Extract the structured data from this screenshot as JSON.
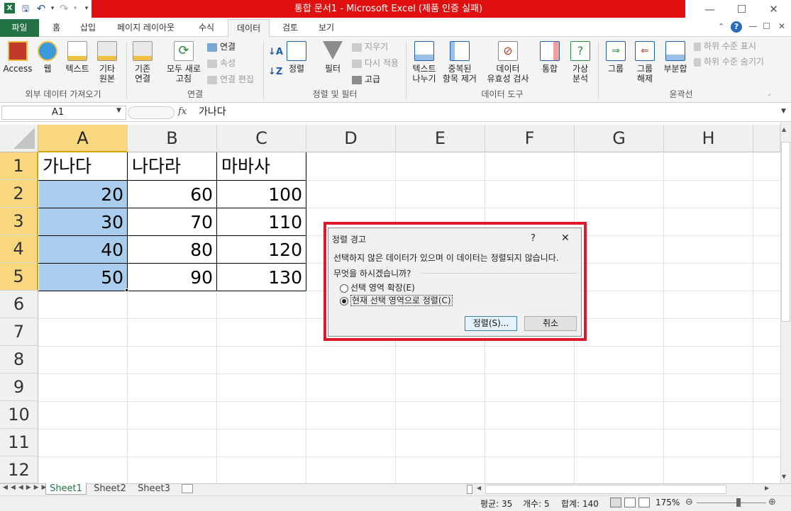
{
  "window": {
    "title": "통합 문서1 - Microsoft Excel (제품 인증 실패)",
    "min_glyph": "—",
    "max_glyph": "☐",
    "close_glyph": "✕"
  },
  "quick_access": {
    "excel_glyph": "X",
    "save_glyph": "🖫",
    "undo_glyph": "↶",
    "redo_glyph": "↷",
    "more_glyph": "▾"
  },
  "ribbon_tabs": [
    "파일",
    "홈",
    "삽입",
    "페이지 레이아웃",
    "수식",
    "데이터",
    "검토",
    "보기"
  ],
  "ribbon": {
    "external": {
      "access": "Access",
      "web": "웹",
      "text": "텍스트",
      "other_1": "기타",
      "other_2": "원본",
      "group": "외부 데이터 가져오기"
    },
    "connections": {
      "existing_1": "기존",
      "existing_2": "연결",
      "refresh_1": "모두 새로",
      "refresh_2": "고침",
      "connections": "연결",
      "properties": "속성",
      "edit_links": "연결 편집",
      "group": "연결"
    },
    "sort_filter": {
      "sort": "정렬",
      "filter": "필터",
      "clear": "지우기",
      "reapply": "다시 적용",
      "advanced": "고급",
      "group": "정렬 및 필터"
    },
    "data_tools": {
      "text_to_columns_1": "텍스트",
      "text_to_columns_2": "나누기",
      "remove_dup_1": "중복된",
      "remove_dup_2": "항목 제거",
      "validation_1": "데이터",
      "validation_2": "유효성 검사",
      "consolidate": "통합",
      "whatif_1": "가상",
      "whatif_2": "분석",
      "group": "데이터 도구"
    },
    "outline": {
      "group_1": "그룹",
      "ungroup_1": "그룹",
      "ungroup_2": "해제",
      "subtotal": "부분합",
      "show_detail": "하위 수준 표시",
      "hide_detail": "하위 수준 숨기기",
      "group": "윤곽선"
    }
  },
  "formula_bar": {
    "name_box": "A1",
    "fx": "fx",
    "value": "가나다"
  },
  "columns": [
    "A",
    "B",
    "C",
    "D",
    "E",
    "F",
    "G",
    "H"
  ],
  "rows": [
    "1",
    "2",
    "3",
    "4",
    "5",
    "6",
    "7",
    "8",
    "9",
    "10",
    "11",
    "12"
  ],
  "cells": {
    "header": [
      "가나다",
      "나다라",
      "마바사"
    ],
    "data": [
      [
        "20",
        "60",
        "100"
      ],
      [
        "30",
        "70",
        "110"
      ],
      [
        "40",
        "80",
        "120"
      ],
      [
        "50",
        "90",
        "130"
      ]
    ]
  },
  "sheets": [
    "Sheet1",
    "Sheet2",
    "Sheet3"
  ],
  "status": {
    "average": "평균: 35",
    "count": "개수: 5",
    "sum": "합계: 140",
    "zoom": "175%"
  },
  "dialog": {
    "title": "정렬 경고",
    "help_glyph": "?",
    "close_glyph": "✕",
    "message": "선택하지 않은 데이터가 있으며 이 데이터는 정렬되지 않습니다.",
    "question": "무엇을 하시겠습니까?",
    "option_expand": "선택 영역 확장(E)",
    "option_current": "현재 선택 영역으로 정렬(C)",
    "sort_button": "정렬(S)...",
    "cancel_button": "취소"
  },
  "colors": {
    "excel_green": "#217346",
    "title_red": "#e01010",
    "selection_fill": "#a9cdec",
    "header_highlight": "#f9d77e",
    "dialog_outline": "#e0182b"
  }
}
